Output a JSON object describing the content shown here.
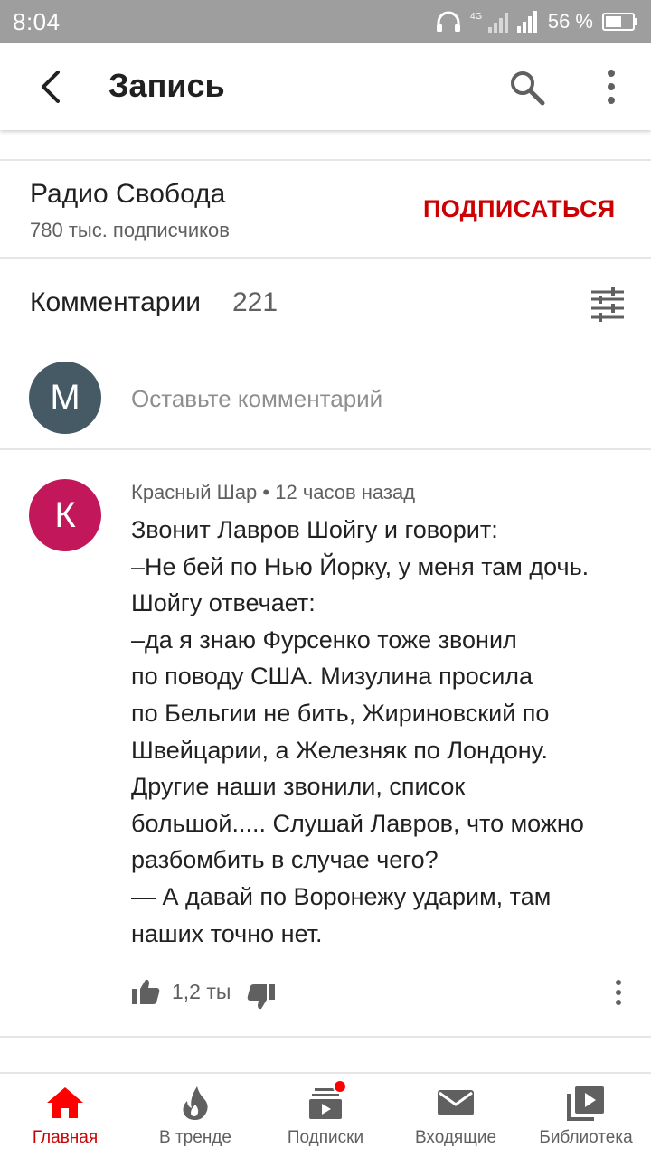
{
  "status_bar": {
    "time": "8:04",
    "network": "4G",
    "battery_percent": "56 %"
  },
  "app_bar": {
    "title": "Запись"
  },
  "channel": {
    "name": "Радио Свобода",
    "subscribers": "780 тыс. подписчиков",
    "subscribe_label": "ПОДПИСАТЬСЯ"
  },
  "comments": {
    "title": "Комментарии",
    "count": "221",
    "input": {
      "avatar_letter": "М",
      "placeholder": "Оставьте комментарий"
    },
    "items": [
      {
        "avatar_letter": "К",
        "author": "Красный Шар",
        "time": "12 часов назад",
        "text": "Звонит Лавров Шойгу и говорит:\n–Не бей по Нью Йорку, у меня там дочь.\nШойгу отвечает:\n–да я знаю Фурсенко тоже звонил\nпо поводу США. Мизулина просила\nпо Бельгии не бить, Жириновский по\nШвейцарии, а Железняк по Лондону.\nДругие наши звонили, список\nбольшой..... Слушай Лавров, что можно\nразбомбить в случае чего?\n— А давай по Воронежу ударим, там\nнаших точно нет.",
        "likes": "1,2 ты"
      }
    ]
  },
  "bottom_nav": {
    "items": [
      {
        "label": "Главная",
        "icon": "home-icon",
        "active": true
      },
      {
        "label": "В тренде",
        "icon": "trending-icon",
        "active": false
      },
      {
        "label": "Подписки",
        "icon": "subscriptions-icon",
        "active": false
      },
      {
        "label": "Входящие",
        "icon": "inbox-icon",
        "active": false
      },
      {
        "label": "Библиотека",
        "icon": "library-icon",
        "active": false
      }
    ]
  },
  "colors": {
    "status_bar": "#9e9e9e",
    "accent_red": "#cc0000",
    "avatar_m": "#455a64",
    "avatar_k": "#c2185b",
    "icon_gray": "#606060"
  }
}
